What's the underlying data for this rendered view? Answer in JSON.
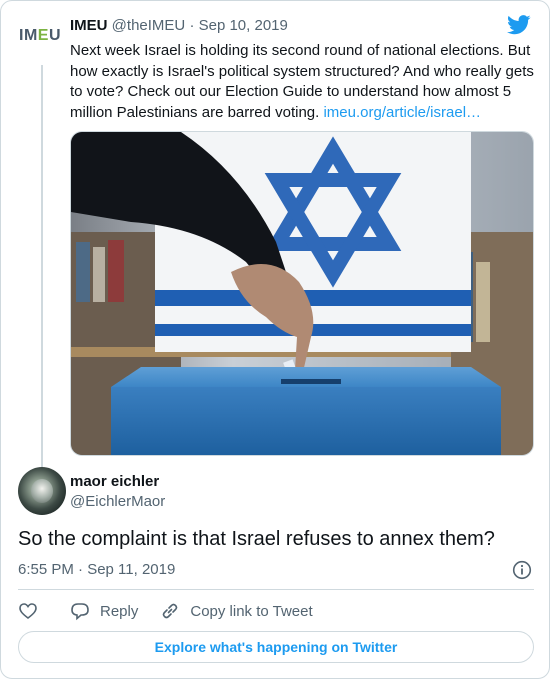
{
  "parent_tweet": {
    "avatar_text": "IMEU",
    "author_name": "IMEU",
    "author_handle": "@theIMEU",
    "separator": "·",
    "date": "Sep 10, 2019",
    "text": "Next week Israel is holding its second round of national elections. But how exactly is Israel's political system structured? And who really gets to vote? Check out our Election Guide to understand how almost 5 million Palestinians are barred voting. ",
    "link": "imeu.org/article/israel…",
    "media_icon": "ballot-box-photo"
  },
  "reply_tweet": {
    "author_name": "maor eichler",
    "author_handle": "@EichlerMaor",
    "text": "So the complaint is that Israel refuses to annex them?",
    "timestamp": "6:55 PM · Sep 11, 2019"
  },
  "actions": {
    "like_icon": "heart-icon",
    "reply_label": "Reply",
    "copy_link_label": "Copy link to Tweet"
  },
  "explore_label": "Explore what's happening on Twitter",
  "colors": {
    "accent": "#1d9bf0",
    "text": "#0f1419",
    "muted": "#536471",
    "border": "#cfd9de"
  }
}
